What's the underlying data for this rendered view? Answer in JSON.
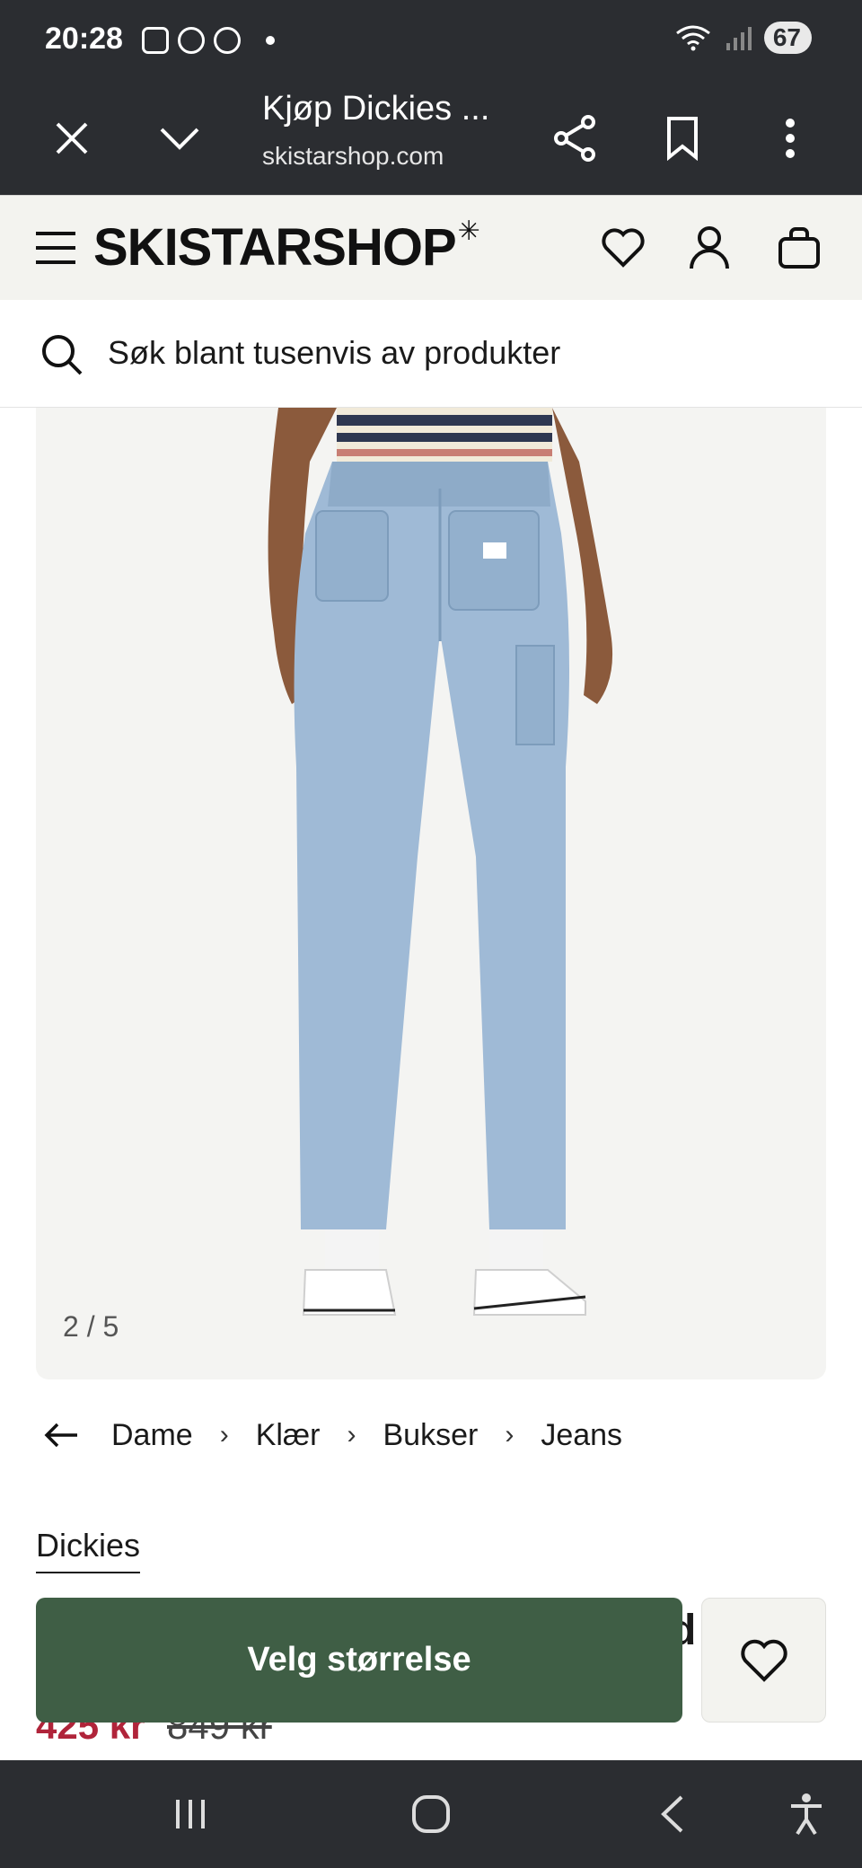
{
  "status": {
    "time": "20:28",
    "battery": "67"
  },
  "browser": {
    "title": "Kjøp Dickies ...",
    "url": "skistarshop.com"
  },
  "site": {
    "logo": "SKISTARSHOP",
    "logo_mark": "✳"
  },
  "search": {
    "placeholder": "Søk blant tusenvis av produkter"
  },
  "gallery": {
    "counter": "2 / 5"
  },
  "breadcrumb": [
    "Dame",
    "Klær",
    "Bukser",
    "Jeans"
  ],
  "product": {
    "brand": "Dickies",
    "title_fragment": "d",
    "price": "425 kr",
    "old_price": "849 kr"
  },
  "cta": {
    "label": "Velg størrelse"
  },
  "colors": {
    "cta": "#3f5e45",
    "price": "#b0243a",
    "chrome": "#2b2d31",
    "header_bg": "#f3f3ef"
  }
}
